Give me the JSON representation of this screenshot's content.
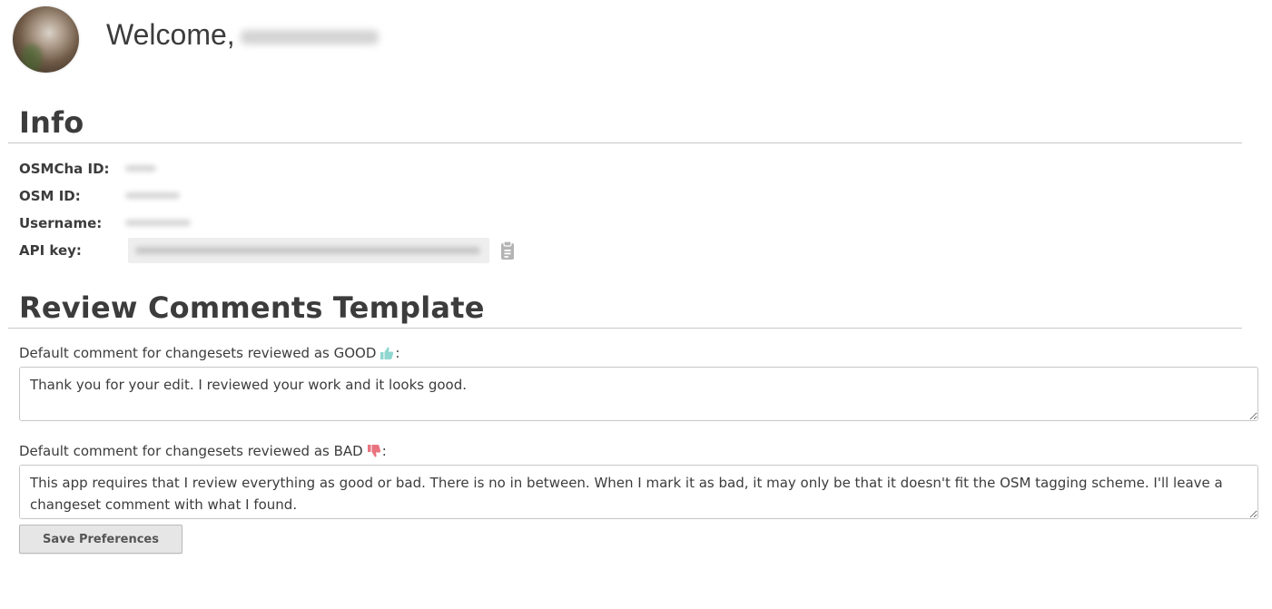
{
  "header": {
    "welcome_text": "Welcome,"
  },
  "info": {
    "title": "Info",
    "fields": [
      {
        "label": "OSMCha ID:"
      },
      {
        "label": "OSM ID:"
      },
      {
        "label": "Username:"
      },
      {
        "label": "API key:"
      }
    ],
    "copy_icon": "clipboard-icon"
  },
  "review_template": {
    "title": "Review Comments Template",
    "good": {
      "label_prefix": "Default comment for changesets reviewed as GOOD",
      "label_suffix": ":",
      "icon": "thumbs-up-icon",
      "icon_color": "#8fd7d0",
      "value": "Thank you for your edit. I reviewed your work and it looks good."
    },
    "bad": {
      "label_prefix": "Default comment for changesets reviewed as BAD",
      "label_suffix": ":",
      "icon": "thumbs-down-icon",
      "icon_color": "#e9747f",
      "value": "This app requires that I review everything as good or bad. There is no in between. When I mark it as bad, it may only be that it doesn't fit the OSM tagging scheme. I'll leave a changeset comment with what I found."
    },
    "save_label": "Save Preferences"
  }
}
